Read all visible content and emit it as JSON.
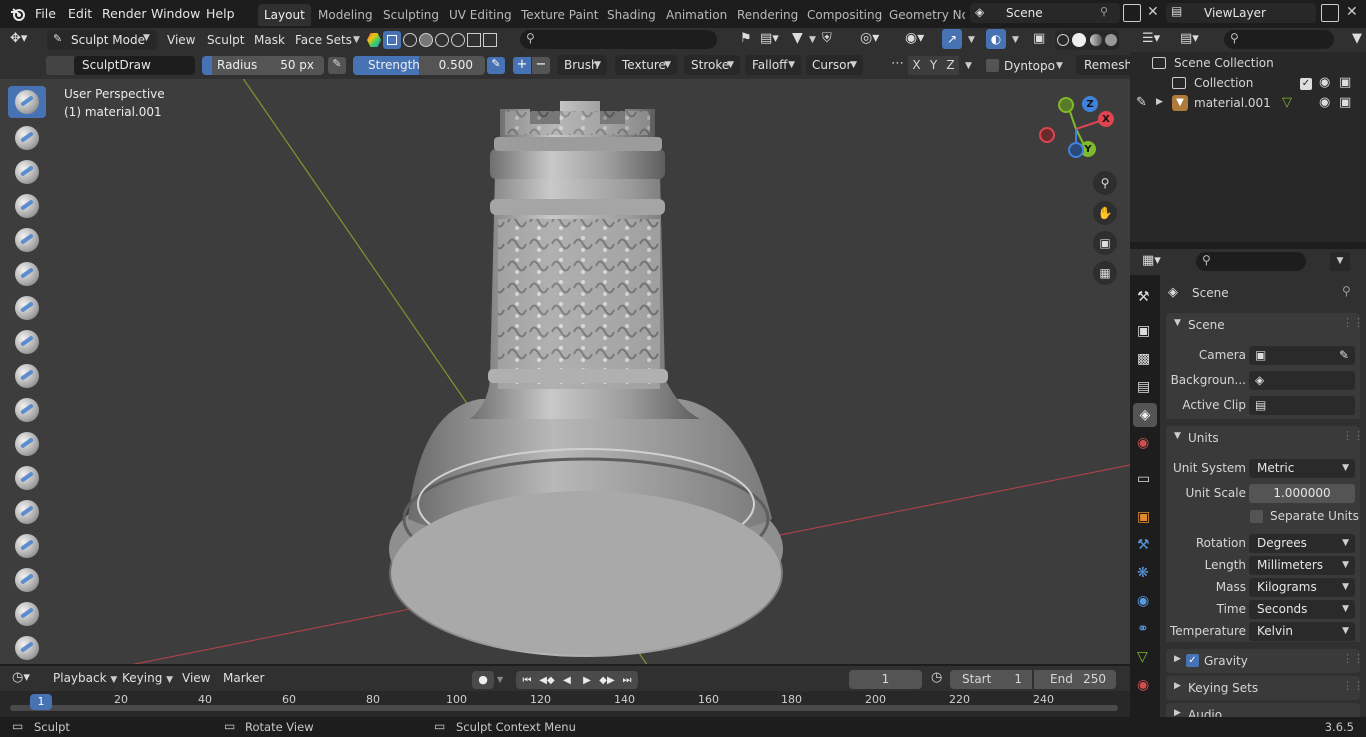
{
  "menu": [
    "File",
    "Edit",
    "Render",
    "Window",
    "Help"
  ],
  "workspaces": [
    "Layout",
    "Modeling",
    "Sculpting",
    "UV Editing",
    "Texture Paint",
    "Shading",
    "Animation",
    "Rendering",
    "Compositing",
    "Geometry Noc"
  ],
  "scene_name": "Scene",
  "view_layer": "ViewLayer",
  "header": {
    "mode": "Sculpt Mode",
    "view": "View",
    "sculpt": "Sculpt",
    "mask": "Mask",
    "face_sets": "Face Sets"
  },
  "tool_settings": {
    "brush_name": "SculptDraw",
    "radius_label": "Radius",
    "radius_value": "50 px",
    "strength_label": "Strength",
    "strength_value": "0.500",
    "brush": "Brush",
    "texture": "Texture",
    "stroke": "Stroke",
    "falloff": "Falloff",
    "cursor": "Cursor",
    "x": "X",
    "y": "Y",
    "z": "Z",
    "dyntopo": "Dyntopo",
    "remesh": "Remesh"
  },
  "viewport": {
    "perspective": "User Perspective",
    "object": "(1) material.001"
  },
  "gizmo": {
    "x": "X",
    "y": "Y",
    "z": "Z"
  },
  "outliner": {
    "scene_collection": "Scene Collection",
    "collection": "Collection",
    "object": "material.001"
  },
  "properties": {
    "context": "Scene",
    "scene_panel": "Scene",
    "camera_label": "Camera",
    "background_label": "Backgroun...",
    "active_clip_label": "Active Clip",
    "units_panel": "Units",
    "unit_system_label": "Unit System",
    "unit_system": "Metric",
    "unit_scale_label": "Unit Scale",
    "unit_scale": "1.000000",
    "separate_units": "Separate Units",
    "rotation_label": "Rotation",
    "rotation": "Degrees",
    "length_label": "Length",
    "length": "Millimeters",
    "mass_label": "Mass",
    "mass": "Kilograms",
    "time_label": "Time",
    "time": "Seconds",
    "temperature_label": "Temperature",
    "temperature": "Kelvin",
    "gravity": "Gravity",
    "keying_sets": "Keying Sets",
    "audio": "Audio"
  },
  "timeline": {
    "playback": "Playback",
    "keying": "Keying",
    "view": "View",
    "marker": "Marker",
    "current_frame": "1",
    "start_label": "Start",
    "start": "1",
    "end_label": "End",
    "end": "250",
    "ticks": [
      "20",
      "40",
      "60",
      "80",
      "100",
      "120",
      "140",
      "160",
      "180",
      "200",
      "220",
      "240"
    ],
    "playhead": "1"
  },
  "status": {
    "left": "Sculpt",
    "middle": "Rotate View",
    "right": "Sculpt Context Menu",
    "version": "3.6.5"
  },
  "colors": {
    "accent": "#4772b3",
    "x_axis": "#e0454f",
    "y_axis": "#7fba2a",
    "z_axis": "#3f82de"
  }
}
